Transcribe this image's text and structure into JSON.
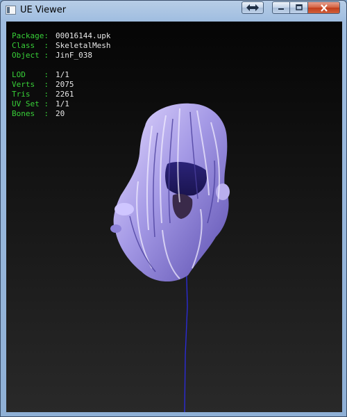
{
  "window": {
    "title": "UE Viewer"
  },
  "titlebar_buttons": {
    "swap": "swap-arrows",
    "minimize": "minimize",
    "maximize": "maximize",
    "close": "close"
  },
  "info": {
    "package_label": "Package:",
    "package_value": "00016144.upk",
    "class_label": "Class  :",
    "class_value": "SkeletalMesh",
    "object_label": "Object :",
    "object_value": "JinF_038",
    "lod_label": "LOD    :",
    "lod_value": "1/1",
    "verts_label": "Verts  :",
    "verts_value": "2075",
    "tris_label": "Tris   :",
    "tris_value": "2261",
    "uvset_label": "UV Set :",
    "uvset_value": "1/1",
    "bones_label": "Bones  :",
    "bones_value": "20"
  },
  "colors": {
    "label": "#38d038",
    "value": "#e8e8e8",
    "bone_line": "#2b2bd6"
  }
}
